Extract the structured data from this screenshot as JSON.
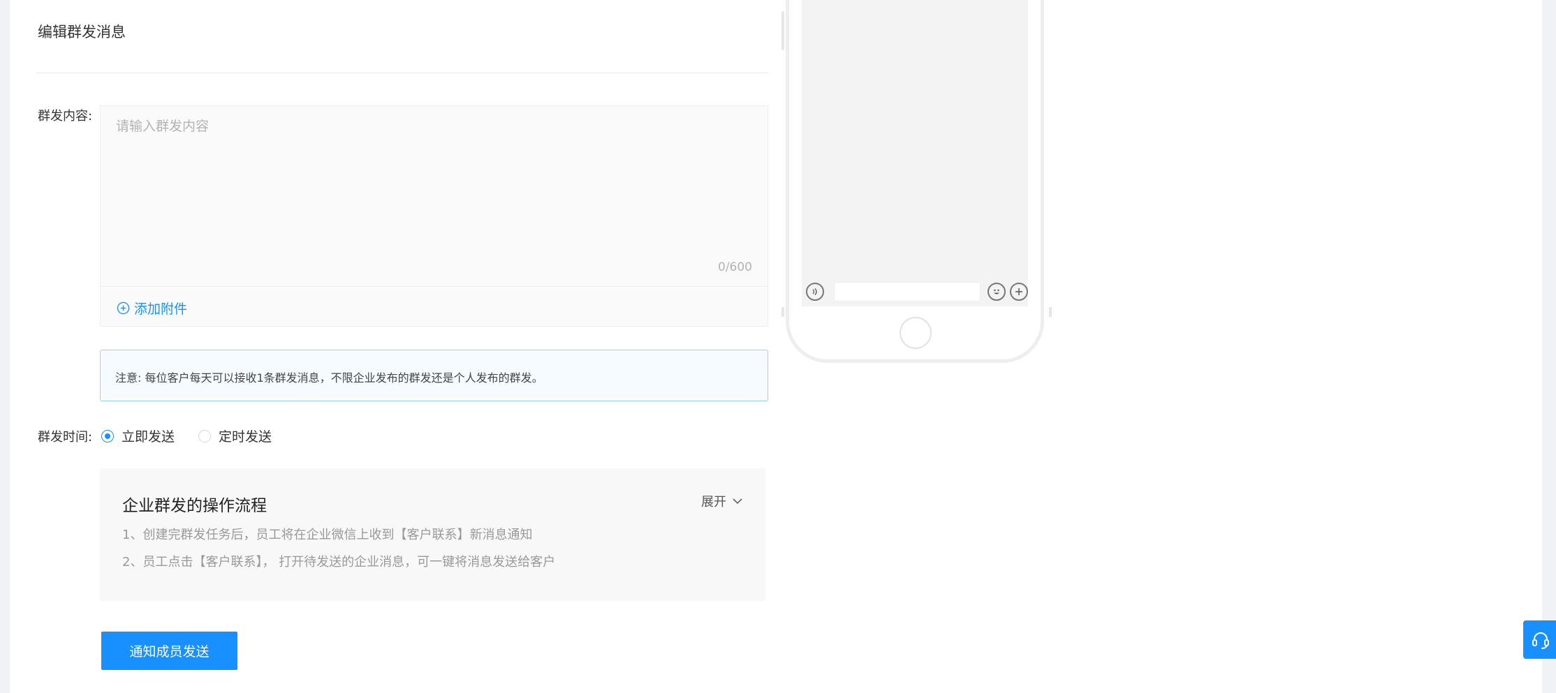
{
  "header": {
    "title": "编辑群发消息"
  },
  "content": {
    "label": "群发内容:",
    "placeholder": "请输入群发内容",
    "value": "",
    "count": "0/600",
    "attach_label": "添加附件"
  },
  "notice": {
    "text": "注意:  每位客户每天可以接收1条群发消息，不限企业发布的群发还是个人发布的群发。"
  },
  "time": {
    "label": "群发时间:",
    "options": [
      {
        "label": "立即发送",
        "checked": true
      },
      {
        "label": "定时发送",
        "checked": false
      }
    ]
  },
  "flow": {
    "title": "企业群发的操作流程",
    "toggle": "展开",
    "steps": [
      "1、创建完群发任务后，员工将在企业微信上收到【客户联系】新消息通知",
      "2、员工点击【客户联系】， 打开待发送的企业消息，可一键将消息发送给客户"
    ]
  },
  "submit": {
    "label": "通知成员发送"
  },
  "colors": {
    "primary": "#1890ff",
    "notice_border": "#91d5ff",
    "notice_bg": "#f5fbff"
  },
  "icons": {
    "attach": "plus-circle-icon",
    "toggle": "chevron-down-icon",
    "voice": "voice-icon",
    "emoji": "emoji-icon",
    "more": "plus-circle-icon",
    "support": "headset-icon"
  }
}
